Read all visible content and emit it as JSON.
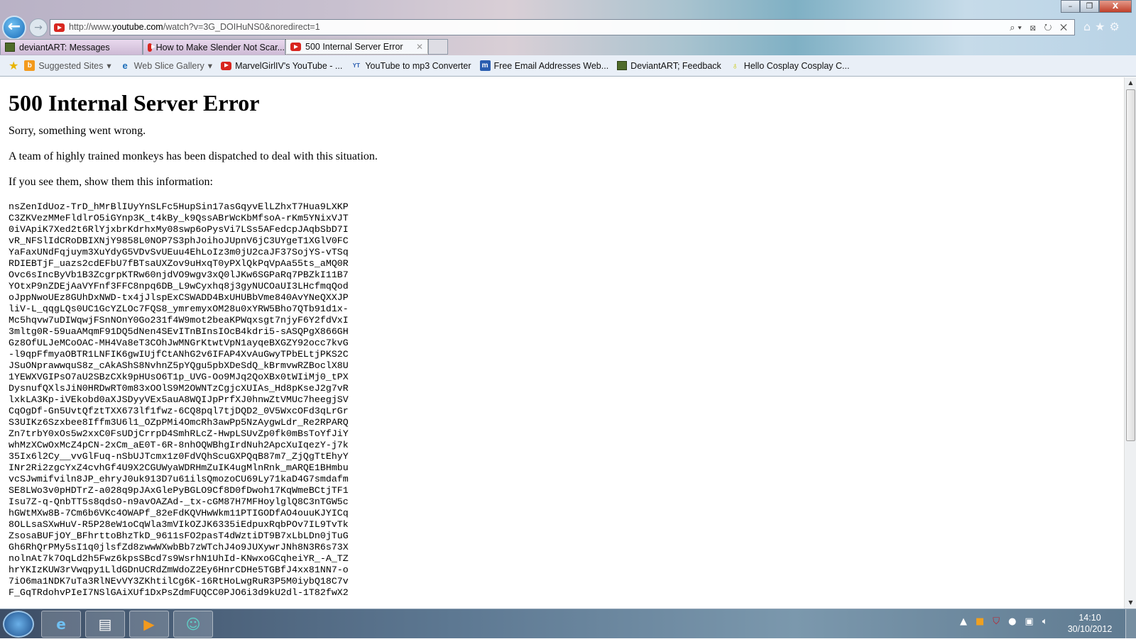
{
  "window": {
    "minimize": "–",
    "restore": "❐",
    "close": "X"
  },
  "address_bar": {
    "url_prefix": "http://www.",
    "url_host": "youtube.com",
    "url_path": "/watch?v=3G_DOIHuNS0&noredirect=1",
    "tools": "⌕▾ ⊠ ↻ ✕"
  },
  "tabs": [
    {
      "label": "deviantART: Messages",
      "icon": "deviantart-icon"
    },
    {
      "label": "How to Make Slender Not Scar...",
      "icon": "youtube-icon"
    },
    {
      "label": "500 Internal Server Error",
      "icon": "youtube-icon",
      "active": true,
      "close": "✕"
    }
  ],
  "favorites": [
    {
      "label": "Suggested Sites",
      "icon": "bing-icon",
      "dropdown": true
    },
    {
      "label": "Web Slice Gallery",
      "icon": "ie-icon",
      "dropdown": true
    },
    {
      "label": "MarvelGirlIV's YouTube - ...",
      "icon": "youtube-icon"
    },
    {
      "label": "YouTube to mp3 Converter",
      "icon": "ytmp3-icon"
    },
    {
      "label": "Free Email Addresses Web...",
      "icon": "mail-icon"
    },
    {
      "label": "DeviantART; Feedback",
      "icon": "deviantart-icon"
    },
    {
      "label": "Hello Cosplay  Cosplay C...",
      "icon": "lightbulb-icon"
    }
  ],
  "page": {
    "title": "500 Internal Server Error",
    "p1": "Sorry, something went wrong.",
    "p2": "A team of highly trained monkeys has been dispatched to deal with this situation.",
    "p3": "If you see them, show them this information:",
    "debug_lines": [
      "nsZenIdUoz-TrD_hMrBlIUyYnSLFc5HupSin17asGqyvElLZhxT7Hua9LXKP",
      "C3ZKVezMMeFldlrO5iGYnp3K_t4kBy_k9QssABrWcKbMfsoA-rKm5YNixVJT",
      "0iVApiK7Xed2t6RlYjxbrKdrhxMy08swp6oPysVi7LSs5AFedcpJAqbSbD7I",
      "vR_NFSlIdCRoDBIXNjY9858L0NOP7S3phJoihoJUpnV6jC3UYgeT1XGlV0FC",
      "YaFaxUNdFqjuym3XuYdyG5VDvSvUEuu4EhLoIz3m0jU2caJF37SojYS-vTSq",
      "RDIEBTjF_uazs2cdEFbU7fBTsaUXZov9uHxqT0yPXlQkPqVpAa55ts_aMQ0R",
      "Ovc6sIncByVb1B3ZcgrpKTRw60njdVO9wgv3xQ0lJKw6SGPaRq7PBZkI11B7",
      "YOtxP9nZDEjAaVYFnf3FFC8npq6DB_L9wCyxhq8j3gyNUCOaUI3LHcfmqQod",
      "oJppNwoUEz8GUhDxNWD-tx4jJlspExCSWADD4BxUHUBbVme840AvYNeQXXJP",
      "liV-L_qqgLQs0UC1GcYZLOc7FQS8_ymremyxOM28u0xYRW5Bho7QTb91d1x-",
      "Mc5hqvw7uDIWqwjFSnNOnY0Go231f4W9mot2beaKPWqxsgt7njyF6Y2fdVxI",
      "3mltg0R-59uaAMqmF91DQ5dNen4SEvITnBInsIOcB4kdri5-sASQPgX866GH",
      "Gz8OfULJeMCoOAC-MH4Va8eT3COhJwMNGrKtwtVpN1ayqeBXGZY92occ7kvG",
      "-l9qpFfmyaOBTR1LNFIK6gwIUjfCtANhG2v6IFAP4XvAuGwyTPbELtjPKS2C",
      "JSuONprawwquS8z_cAkAShS8NvhnZ5pYQgu5pbXDeSdQ_kBrmvwRZBoclX8U",
      "1YEWXVGIPsO7aU2SBzCXk9pHUsO6T1p_UVG-Oo9MJq2QoXBx0tWIiMj0_tPX",
      "DysnufQXlsJiN0HRDwRT0m83xOOlS9M2OWNTzCgjcXUIAs_Hd8pKseJ2g7vR",
      "lxkLA3Kp-iVEkobd0aXJSDyyVEx5auA8WQIJpPrfXJ0hnwZtVMUc7heegjSV",
      "CqOgDf-Gn5UvtQfztTXX673lf1fwz-6CQ8pql7tjDQD2_0V5WxcOFd3qLrGr",
      "S3UIKz6Szxbee8Iffm3U6l1_OZpPMi4OmcRh3awPp5NzAygwLdr_Re2RPARQ",
      "Zn7trbY0xOs5w2xxC0FsUDjCrrpD4SmhRLcZ-HwpLSUvZp0fk0mBsToYfJiY",
      "whMzXCwOxMcZ4pCN-2xCm_aE0T-6R-8nhOQWBhgIrdNuh2ApcXuIqezY-j7k",
      "35Ix6l2Cy__vvGlFuq-nSbUJTcmx1z0FdVQhScuGXPQqB87m7_ZjQgTtEhyY",
      "INr2Ri2zgcYxZ4cvhGf4U9X2CGUWyaWDRHmZuIK4ugMlnRnk_mARQE1BHmbu",
      "vcSJwmifviln8JP_ehryJ0uk913D7u61ilsQmozoCU69Ly71kaD4G7smdafm",
      "SE8LWo3v0pHDTrZ-a028q9pJAxGlePyBGLO9Cf8D0fDwoh17KqWmeBCtjTF1",
      "Isu7Z-q-QnbTT5s8qdsO-n9avOAZAd-_tx-cGM87H7MFHoylglQ8C3nTGW5c",
      "hGWtMXw8B-7Cm6b6VKc4OWAPf_82eFdKQVHwWkm11PTIGODfAO4ouuKJYICq",
      "8OLLsaSXwHuV-R5P28eW1oCqWla3mVIkOZJK6335iEdpuxRqbPOv7IL9TvTk",
      "ZsosaBUFjOY_BFhrttoBhzTkD_9611sFO2pasT4dWztiDT9B7xLbLDn0jTuG",
      "Gh6RhQrPMy5sI1q0jlsfZd8zwwWXwbBb7zWTchJ4o9JUXywrJNh8N3R6s73X",
      "nolnAt7k7OqLd2h5Fwz6kpsSBcd7s9WsrhN1UhId-KNwxoGCqheiYR_-A_TZ",
      "hrYKIzKUW3rVwqpy1LldGDnUCRdZmWdoZ2Ey6HnrCDHe5TGBfJ4xx81NN7-o",
      "7iO6ma1NDK7uTa3RlNEvVY3ZKhtilCg6K-16RtHoLwgRuR3P5M0iybQ18C7v",
      "F_GqTRdohvPIeI7NSlGAiXUf1DxPsZdmFUQCC0PJO6i3d9kU2dl-1T82fwX2"
    ]
  },
  "taskbar": {
    "time": "14:10",
    "date": "30/10/2012",
    "apps": [
      "internet-explorer",
      "file-explorer",
      "media-player",
      "anime-character-app"
    ]
  },
  "colors": {
    "youtube_red": "#d8261f",
    "ie_blue": "#1a6cb8"
  }
}
